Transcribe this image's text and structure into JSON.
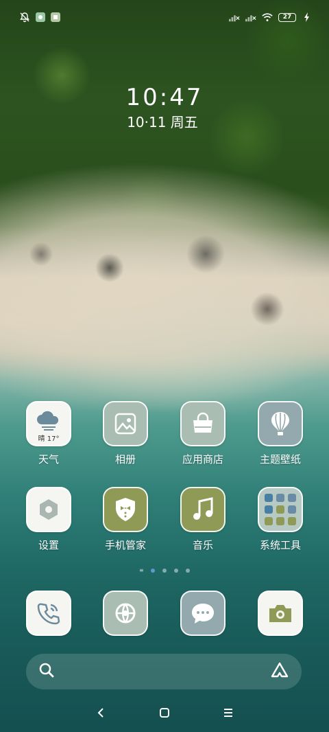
{
  "status_bar": {
    "battery_level": "27",
    "icons": [
      "notifications-off-icon",
      "app-notification-icon",
      "app-notification-icon",
      "signal-icon",
      "signal-icon",
      "wifi-icon",
      "battery-icon",
      "charging-icon"
    ]
  },
  "lockclock": {
    "time": "10:47",
    "date": "10·11  周五"
  },
  "home_apps": [
    {
      "label": "天气",
      "icon": "weather-icon",
      "weather_text": "晴 17°"
    },
    {
      "label": "相册",
      "icon": "gallery-icon"
    },
    {
      "label": "应用商店",
      "icon": "app-store-icon"
    },
    {
      "label": "主题壁纸",
      "icon": "themes-icon"
    },
    {
      "label": "设置",
      "icon": "settings-icon"
    },
    {
      "label": "手机管家",
      "icon": "security-icon"
    },
    {
      "label": "音乐",
      "icon": "music-icon"
    },
    {
      "label": "系统工具",
      "icon": "folder-icon"
    }
  ],
  "dock": [
    {
      "icon": "phone-icon"
    },
    {
      "icon": "browser-icon"
    },
    {
      "icon": "messages-icon"
    },
    {
      "icon": "camera-icon"
    }
  ],
  "pager": {
    "pages": 4,
    "active": 1
  },
  "colors": {
    "tile_white": "#f5f6f2",
    "tile_sage": "#a9bdb3",
    "tile_slate": "#93a9ad",
    "tile_olive": "#8e9a56",
    "pager_active": "#5b9bd1"
  }
}
